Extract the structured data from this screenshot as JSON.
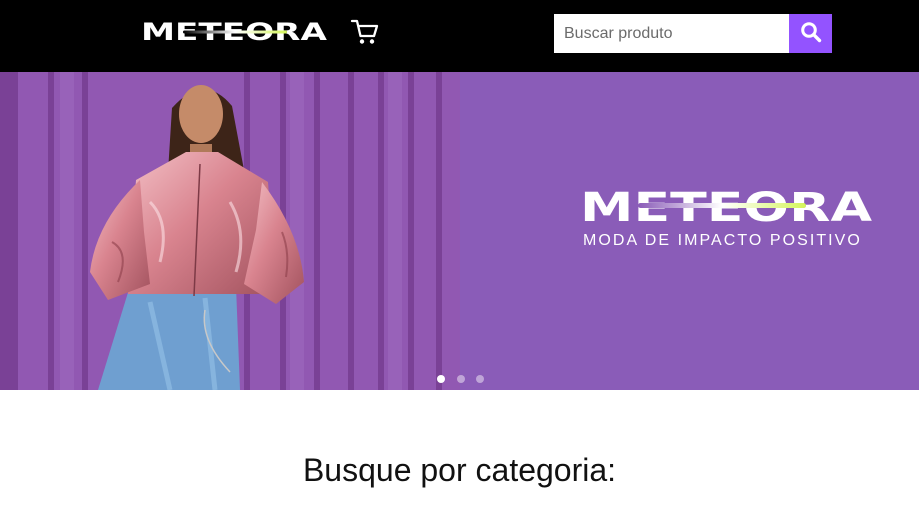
{
  "header": {
    "logo_text": "METEORA",
    "cart_icon": "shopping-cart-icon",
    "search": {
      "placeholder": "Buscar produto",
      "value": "",
      "button_icon": "search-icon"
    }
  },
  "banner": {
    "logo_text": "METEORA",
    "tagline": "MODA DE IMPACTO POSITIVO",
    "slides_total": 3,
    "active_slide": 1
  },
  "categories": {
    "heading": "Busque por categoria:"
  },
  "colors": {
    "header_bg": "#000000",
    "accent_purple": "#9353ff",
    "banner_purple": "#8a5cb8",
    "logo_lime": "#d4f65a"
  }
}
